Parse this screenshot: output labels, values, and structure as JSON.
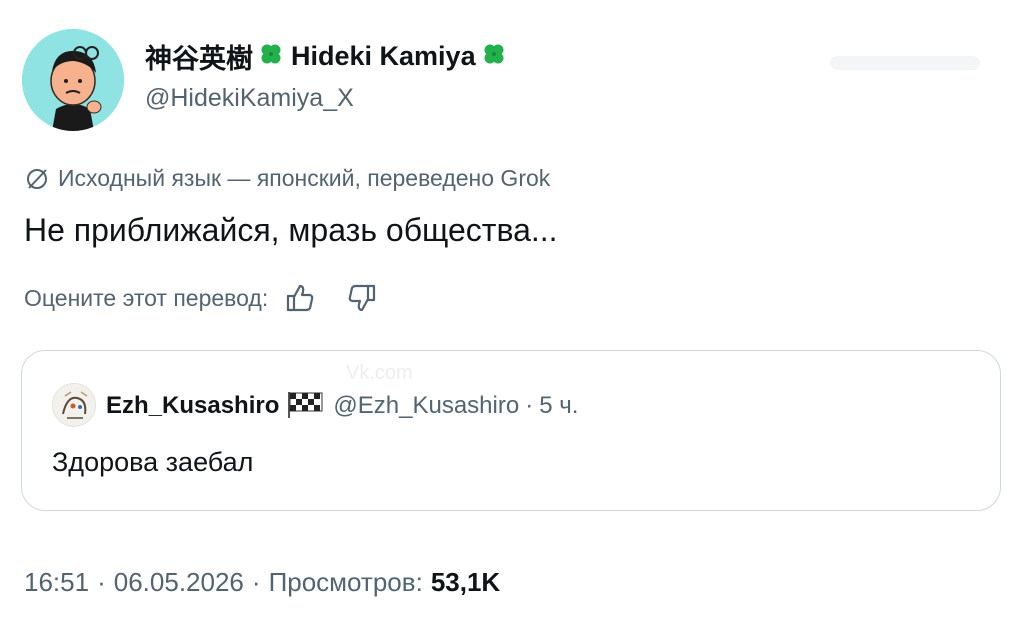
{
  "author": {
    "display_name_jp": "神谷英樹",
    "display_name_en": "Hideki Kamiya",
    "handle": "@HidekiKamiya_X",
    "avatar_icon": "cartoon-avatar-icon",
    "badge_icon": "four-leaf-clover-icon"
  },
  "translation": {
    "note": "Исходный язык — японский, переведено Grok",
    "text": "Не приближайся, мразь общества...",
    "rate_label": "Оцените этот перевод:"
  },
  "quote": {
    "display_name": "Ezh_Kusashiro",
    "badge_icon": "checkered-flag-icon",
    "handle": "@Ezh_Kusashiro",
    "time": "5 ч.",
    "text": "Здорова заебал",
    "watermark": "Vk.com"
  },
  "meta": {
    "time": "16:51",
    "date": "06.05.2026",
    "views_label": "Просмотров:",
    "views_count": "53,1K"
  },
  "colors": {
    "text_primary": "#0f1419",
    "text_secondary": "#536471",
    "border": "#cfd9de",
    "avatar_bg": "#8fe3e3",
    "clover": "#22b14c"
  }
}
